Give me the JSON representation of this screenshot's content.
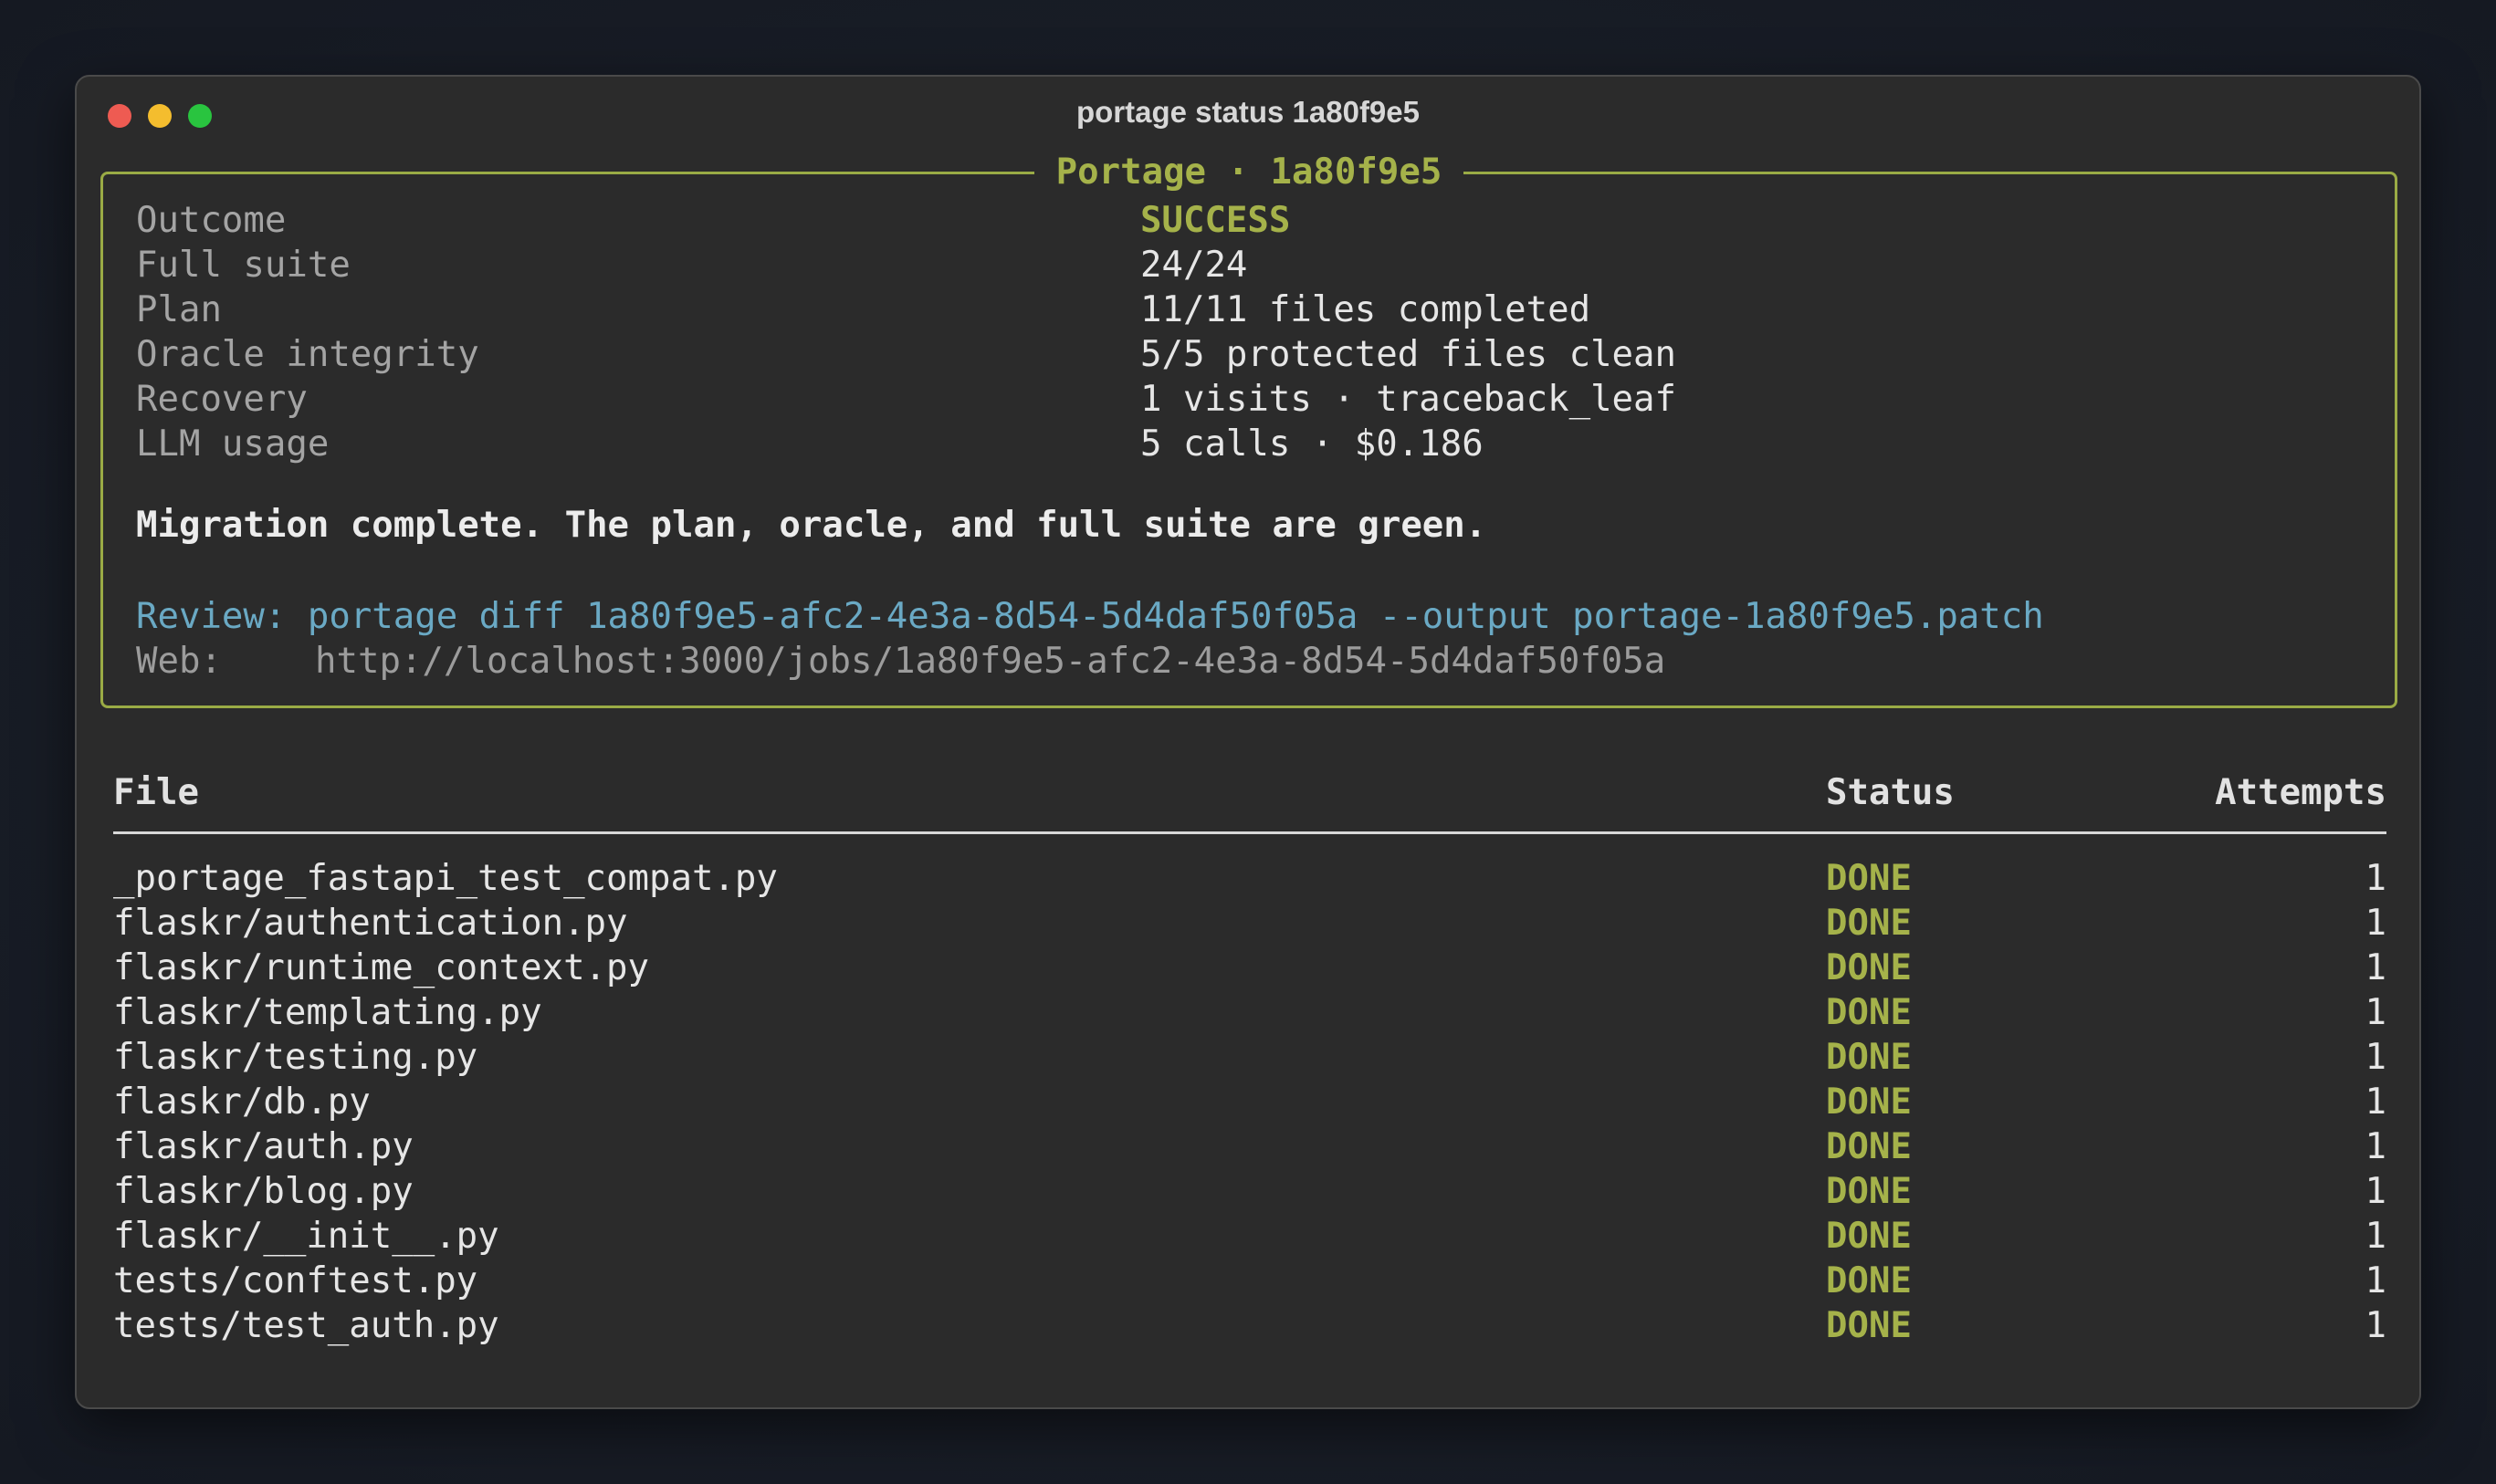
{
  "window": {
    "title": "portage status 1a80f9e5"
  },
  "panel": {
    "title": "Portage · 1a80f9e5",
    "rows": [
      {
        "key": "Outcome",
        "value": "SUCCESS"
      },
      {
        "key": "Full suite",
        "value": "24/24"
      },
      {
        "key": "Plan",
        "value": "11/11 files completed"
      },
      {
        "key": "Oracle integrity",
        "value": "5/5 protected files clean"
      },
      {
        "key": "Recovery",
        "value": "1 visits · traceback_leaf"
      },
      {
        "key": "LLM usage",
        "value": "5 calls · $0.186"
      }
    ],
    "message": "Migration complete. The plan, oracle, and full suite are green.",
    "review": "Review: portage diff 1a80f9e5-afc2-4e3a-8d54-5d4daf50f05a --output portage-1a80f9e5.patch",
    "web_label": "Web:",
    "web_url": "http://localhost:3000/jobs/1a80f9e5-afc2-4e3a-8d54-5d4daf50f05a"
  },
  "colors": {
    "accent": "#a5b24a",
    "link": "#6aa9c4",
    "background": "#2b2b2b"
  },
  "table": {
    "headers": {
      "file": "File",
      "status": "Status",
      "attempts": "Attempts"
    },
    "rows": [
      {
        "file": "_portage_fastapi_test_compat.py",
        "status": "DONE",
        "attempts": "1"
      },
      {
        "file": "flaskr/authentication.py",
        "status": "DONE",
        "attempts": "1"
      },
      {
        "file": "flaskr/runtime_context.py",
        "status": "DONE",
        "attempts": "1"
      },
      {
        "file": "flaskr/templating.py",
        "status": "DONE",
        "attempts": "1"
      },
      {
        "file": "flaskr/testing.py",
        "status": "DONE",
        "attempts": "1"
      },
      {
        "file": "flaskr/db.py",
        "status": "DONE",
        "attempts": "1"
      },
      {
        "file": "flaskr/auth.py",
        "status": "DONE",
        "attempts": "1"
      },
      {
        "file": "flaskr/blog.py",
        "status": "DONE",
        "attempts": "1"
      },
      {
        "file": "flaskr/__init__.py",
        "status": "DONE",
        "attempts": "1"
      },
      {
        "file": "tests/conftest.py",
        "status": "DONE",
        "attempts": "1"
      },
      {
        "file": "tests/test_auth.py",
        "status": "DONE",
        "attempts": "1"
      }
    ]
  }
}
